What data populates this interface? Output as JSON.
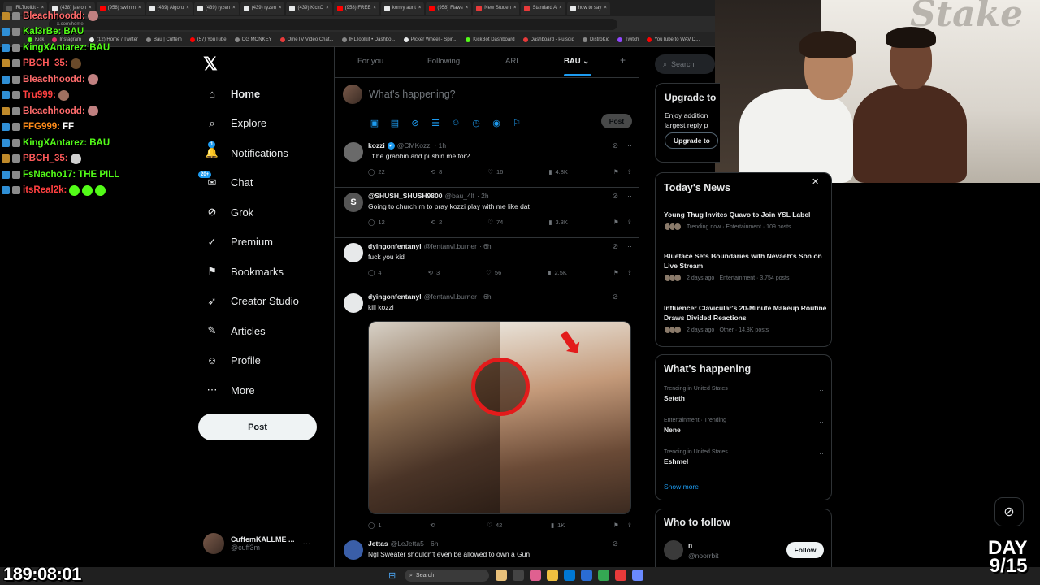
{
  "browser": {
    "tabs": [
      {
        "label": "IRLToolkit -",
        "color": "#5a5a5a"
      },
      {
        "label": "(438) jae on",
        "color": "#e7e9ea"
      },
      {
        "label": "(958) swimm",
        "color": "#ff0000"
      },
      {
        "label": "(439) Algoru",
        "color": "#e7e9ea"
      },
      {
        "label": "(439) ryzen",
        "color": "#e7e9ea"
      },
      {
        "label": "(439) ryzen",
        "color": "#e7e9ea"
      },
      {
        "label": "(439) KickO",
        "color": "#e7e9ea"
      },
      {
        "label": "(958) FREE",
        "color": "#ff0000"
      },
      {
        "label": "konvy aunt",
        "color": "#e7e9ea"
      },
      {
        "label": "(958) Flaws",
        "color": "#ff0000"
      },
      {
        "label": "New Studen",
        "color": "#e83a3a"
      },
      {
        "label": "Standard A",
        "color": "#e83a3a"
      },
      {
        "label": "how to say",
        "color": "#e7e9ea"
      }
    ],
    "url": "x.com/home",
    "bookmarks": [
      {
        "label": "Kick",
        "color": "#53fc18"
      },
      {
        "label": "Instagram",
        "color": "#e1306c"
      },
      {
        "label": "(12) Home / Twitter",
        "color": "#e7e9ea"
      },
      {
        "label": "Bau | Cuffem",
        "color": "#888888"
      },
      {
        "label": "(57) YouTube",
        "color": "#ff0000"
      },
      {
        "label": "OG MONKEY",
        "color": "#888888"
      },
      {
        "label": "OmeTV Video Chat...",
        "color": "#e83a3a"
      },
      {
        "label": "IRLToolkit • Dashbo...",
        "color": "#888888"
      },
      {
        "label": "Picker Wheel - Spin...",
        "color": "#e7e9ea"
      },
      {
        "label": "KickBot Dashboard",
        "color": "#53fc18"
      },
      {
        "label": "Dashboard - Pulsoid",
        "color": "#e83a3a"
      },
      {
        "label": "DistroKid",
        "color": "#888888"
      },
      {
        "label": "Twitch",
        "color": "#9146ff"
      },
      {
        "label": "YouTube to WAV D...",
        "color": "#ff0000"
      }
    ]
  },
  "chat": [
    {
      "user": "Bleachhoodd:",
      "msg": "",
      "color": "#ff6b6b",
      "emotes": [
        "#c08080"
      ]
    },
    {
      "user": "Kal3rBe:",
      "msg": "BAU",
      "color": "#53fc18",
      "emotes": []
    },
    {
      "user": "KingXAntarez:",
      "msg": "BAU",
      "color": "#53fc18",
      "emotes": []
    },
    {
      "user": "PBCH_35:",
      "msg": "",
      "color": "#ff5a5a",
      "emotes": [
        "#6a4a2a"
      ]
    },
    {
      "user": "Bleachhoodd:",
      "msg": "",
      "color": "#ff6b6b",
      "emotes": [
        "#c08080"
      ]
    },
    {
      "user": "Tru999:",
      "msg": "",
      "color": "#ff4040",
      "emotes": [
        "#a07060"
      ]
    },
    {
      "user": "Bleachhoodd:",
      "msg": "",
      "color": "#ff6b6b",
      "emotes": [
        "#c08080"
      ]
    },
    {
      "user": "FFG999:",
      "msg": "FF",
      "color": "#ff8c1a",
      "emotes": []
    },
    {
      "user": "KingXAntarez:",
      "msg": "BAU",
      "color": "#53fc18",
      "emotes": []
    },
    {
      "user": "PBCH_35:",
      "msg": "",
      "color": "#ff5a5a",
      "emotes": [
        "#d0d0d0"
      ]
    },
    {
      "user": "FsNacho17:",
      "msg": "THE PILL",
      "color": "#53fc18",
      "emotes": []
    },
    {
      "user": "itsReal2k:",
      "msg": "",
      "color": "#ff4040",
      "emotes": [
        "#53fc18",
        "#53fc18",
        "#53fc18"
      ]
    }
  ],
  "nav": {
    "items": [
      {
        "label": "Home",
        "icon": "home-icon",
        "glyph": "⌂",
        "active": true
      },
      {
        "label": "Explore",
        "icon": "search-icon",
        "glyph": "⌕",
        "active": false
      },
      {
        "label": "Notifications",
        "icon": "bell-icon",
        "glyph": "🔔",
        "active": false,
        "badge": "1"
      },
      {
        "label": "Chat",
        "icon": "chat-icon",
        "glyph": "✉",
        "active": false,
        "badge": "20+"
      },
      {
        "label": "Grok",
        "icon": "grok-icon",
        "glyph": "⊘",
        "active": false
      },
      {
        "label": "Premium",
        "icon": "verified-icon",
        "glyph": "✓",
        "active": false
      },
      {
        "label": "Bookmarks",
        "icon": "bookmark-icon",
        "glyph": "⚑",
        "active": false
      },
      {
        "label": "Creator Studio",
        "icon": "rocket-icon",
        "glyph": "➶",
        "active": false
      },
      {
        "label": "Articles",
        "icon": "article-icon",
        "glyph": "✎",
        "active": false
      },
      {
        "label": "Profile",
        "icon": "person-icon",
        "glyph": "☺",
        "active": false
      },
      {
        "label": "More",
        "icon": "more-circle-icon",
        "glyph": "⋯",
        "active": false
      }
    ],
    "post_label": "Post",
    "account": {
      "name": "CuffemKALLME ...",
      "handle": "@cuff3m"
    }
  },
  "feed": {
    "tabs": [
      "For you",
      "Following",
      "ARL",
      "BAU"
    ],
    "active_tab": "BAU",
    "composer_placeholder": "What's happening?",
    "composer_post": "Post",
    "tweets": [
      {
        "name": "kozzi",
        "verified": true,
        "handle": "@CMKozzi",
        "time": "· 1h",
        "text": "Tf he grabbin and pushin me for?",
        "replies": "22",
        "reposts": "8",
        "likes": "16",
        "views": "4.8K",
        "avatar": "#6a6a6a"
      },
      {
        "name": "@SHUSH_SHUSH9800",
        "verified": false,
        "handle": "@bau_4lf",
        "time": "· 2h",
        "text": "Going to church rn to pray kozzi play with me like dat",
        "replies": "12",
        "reposts": "2",
        "likes": "74",
        "views": "3.3K",
        "avatar": "#555555",
        "avatar_letter": "S"
      },
      {
        "name": "dyingonfentanyl",
        "verified": false,
        "handle": "@fentanvl.burner",
        "time": "· 6h",
        "text": "fuck you kid",
        "replies": "4",
        "reposts": "3",
        "likes": "56",
        "views": "2.5K",
        "avatar": "#e7e9ea"
      },
      {
        "name": "dyingonfentanyl",
        "verified": false,
        "handle": "@fentanvl.burner",
        "time": "· 6h",
        "text": "kill kozzi",
        "replies": "1",
        "reposts": "",
        "likes": "42",
        "views": "1K",
        "avatar": "#e7e9ea",
        "has_media": true
      },
      {
        "name": "Jettas",
        "verified": false,
        "handle": "@LeJetta5",
        "time": "· 6h",
        "text": "Ngl Sweater shouldn't even be allowed to own a Gun",
        "avatar": "#3a5ea8"
      }
    ]
  },
  "right": {
    "search_placeholder": "Search",
    "upgrade": {
      "title": "Upgrade to",
      "text_line1": "Enjoy addition",
      "text_line2": "largest reply p",
      "button": "Upgrade to"
    },
    "news": {
      "title": "Today's News",
      "items": [
        {
          "headline": "Young Thug Invites Quavo to Join YSL Label",
          "meta": "Trending now · Entertainment · 109 posts"
        },
        {
          "headline": "Blueface Sets Boundaries with Nevaeh's Son on Live Stream",
          "meta": "2 days ago · Entertainment · 3,754 posts"
        },
        {
          "headline": "Influencer Clavicular's 20-Minute Makeup Routine Draws Divided Reactions",
          "meta": "2 days ago · Other · 14.8K posts"
        }
      ]
    },
    "happening": {
      "title": "What's happening",
      "trends": [
        {
          "meta": "Trending in United States",
          "name": "Seteth"
        },
        {
          "meta": "Entertainment · Trending",
          "name": "Nene"
        },
        {
          "meta": "Trending in United States",
          "name": "Eshmel"
        }
      ],
      "show_more": "Show more"
    },
    "follow": {
      "title": "Who to follow",
      "name": "n",
      "handle": "@noorrbit",
      "button": "Follow"
    }
  },
  "overlay": {
    "timer": "189:08:01",
    "day_line1": "DAY",
    "day_line2": "9/15",
    "cam_brand": "Stake"
  },
  "taskbar": {
    "search_label": "Search",
    "icons": [
      "#e8c07a",
      "#444444",
      "#e06090",
      "#f0c040",
      "#0078d4",
      "#2a6cd4",
      "#34a853",
      "#e83a3a",
      "#6a8aff"
    ]
  },
  "colors": {
    "accent": "#1d9bf0",
    "verified": "#1d9bf0",
    "kick_green": "#53fc18"
  }
}
